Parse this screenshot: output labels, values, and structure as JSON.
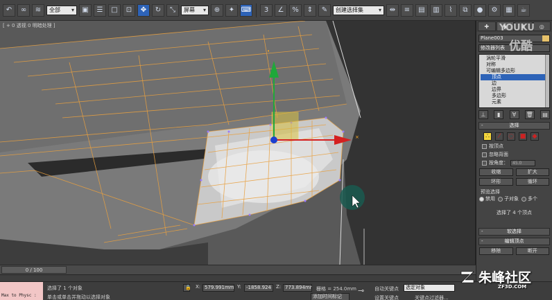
{
  "toolbar": {
    "filter_select": "全部",
    "refcoord_select": "屏幕",
    "named_selection": "创建选择集"
  },
  "viewport": {
    "label": "[ + 0 透视 0 明暗处理 ]"
  },
  "timeslider": {
    "frame_label": "0 / 100"
  },
  "command_panel": {
    "object_name": "Plane003",
    "modifier_list": "修改器列表",
    "stack_items": [
      {
        "label": "涡轮平滑",
        "selected": false,
        "indent": false
      },
      {
        "label": "对称",
        "selected": false,
        "indent": false
      },
      {
        "label": "可编辑多边形",
        "selected": false,
        "indent": false
      },
      {
        "label": "顶点",
        "selected": true,
        "indent": true
      },
      {
        "label": "边",
        "selected": false,
        "indent": true
      },
      {
        "label": "边界",
        "selected": false,
        "indent": true
      },
      {
        "label": "多边形",
        "selected": false,
        "indent": true
      },
      {
        "label": "元素",
        "selected": false,
        "indent": true
      }
    ],
    "selection_rollout": "选择",
    "by_vertex": "按顶点",
    "ignore_backfacing": "忽略背面",
    "by_angle": "按角度：",
    "angle_value": "45.0",
    "shrink": "收缩",
    "grow": "扩大",
    "ring": "环形",
    "loop": "循环",
    "preview_selection": "预览选择",
    "preview_off": "禁用",
    "preview_subobj": "子对象",
    "preview_multi": "多个",
    "selection_info": "选择了 4 个顶点",
    "soft_selection": "软选择",
    "edit_vertices": "编辑顶点",
    "remove": "移除",
    "break": "断开"
  },
  "statusbar": {
    "maxscript": "Max to Physc :",
    "selected_text": "选择了 1 个对象",
    "prompt_text": "单击或单击并拖动以选择对象",
    "x_label": "X:",
    "x_value": "579.991mm",
    "y_label": "Y:",
    "y_value": "-1858.924",
    "z_label": "Z:",
    "z_value": "773.894mr",
    "grid": "栅格 = 254.0mm",
    "autokey": "自动关键点",
    "key_select": "选定对象",
    "set_key": "设置关键点",
    "key_filters": "关键点过滤器...",
    "add_time_tag": "添加时间标记"
  },
  "watermark": {
    "youku_top": "YOUKU",
    "youku_bottom": "优酷",
    "zf_title": "朱峰社区",
    "zf_url": "ZF3D.COM"
  },
  "colors": {
    "accent": "#2d63b8",
    "gizmo_y": "#1fa83a",
    "gizmo_x": "#d42020",
    "gizmo_center": "#1c3fd0",
    "wire": "#e8a040"
  }
}
